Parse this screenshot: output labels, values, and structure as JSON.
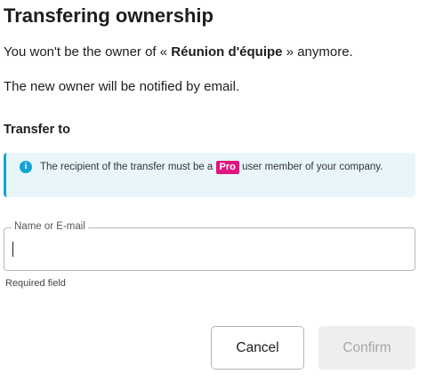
{
  "dialog": {
    "title": "Transfering ownership",
    "description": {
      "prefix": "You won't be the owner of « ",
      "document_name": "Réunion d'équipe",
      "suffix": " » anymore."
    },
    "notification_text": "The new owner will be notified by email.",
    "section_label": "Transfer to",
    "alert": {
      "icon": "info-icon",
      "text_before": "The recipient of the transfer must be a ",
      "badge": "Pro",
      "text_after": " user member of your company.",
      "colors": {
        "background": "#e8f6fb",
        "accent": "#12a3d6",
        "badge": "#e0147e"
      }
    },
    "field": {
      "label": "Name or E-mail",
      "value": "",
      "helper": "Required field"
    },
    "buttons": {
      "cancel": "Cancel",
      "confirm": "Confirm",
      "confirm_disabled": true
    }
  }
}
